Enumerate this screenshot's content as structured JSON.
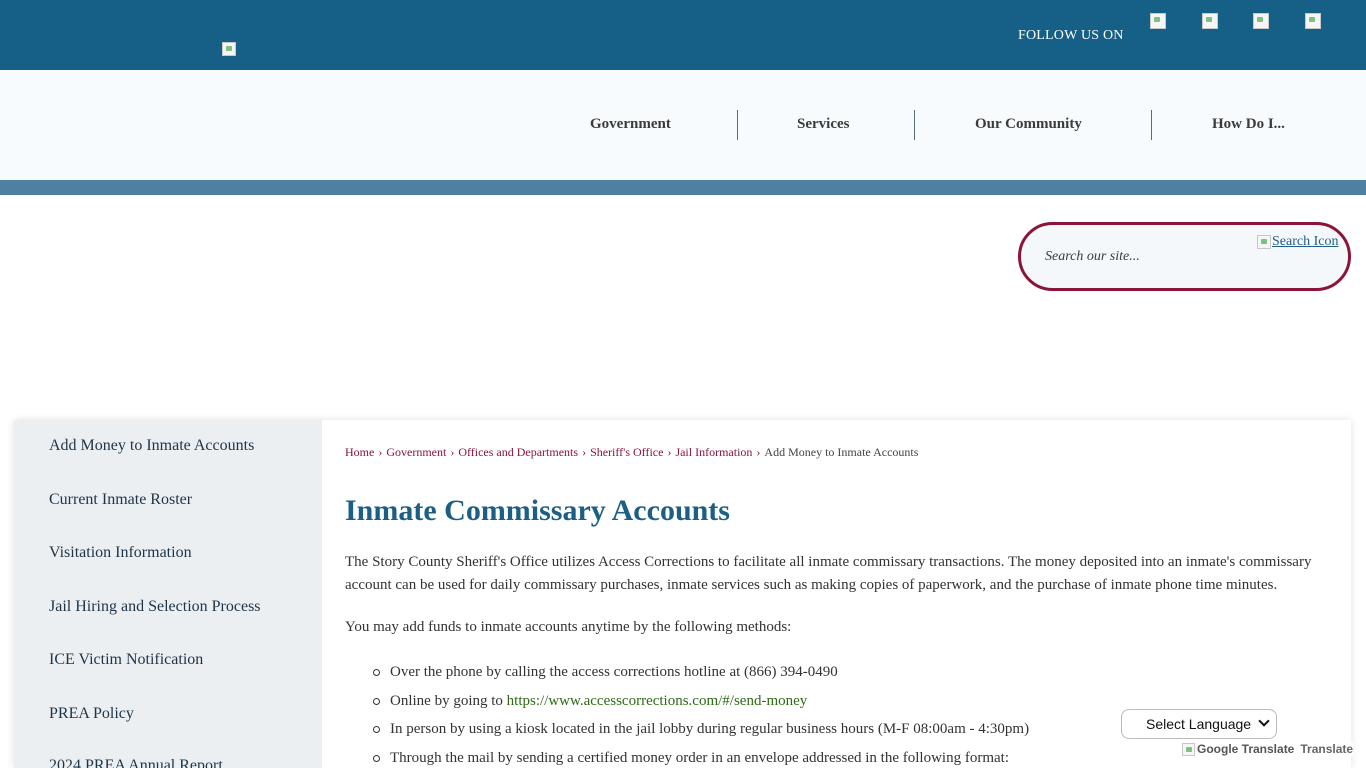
{
  "header": {
    "follow_label": "FOLLOW US ON"
  },
  "nav": {
    "items": [
      "Government",
      "Services",
      "Our Community",
      "How Do I..."
    ]
  },
  "search": {
    "placeholder": "Search our site...",
    "icon_alt": "Search Icon"
  },
  "sidebar": {
    "items": [
      "Add Money to Inmate Accounts",
      "Current Inmate Roster",
      "Visitation Information",
      "Jail Hiring and Selection Process",
      "ICE Victim Notification",
      "PREA Policy",
      "2024 PREA Annual Report"
    ]
  },
  "breadcrumb": {
    "items": [
      "Home",
      "Government",
      "Offices and Departments",
      "Sheriff's Office",
      "Jail Information"
    ],
    "separator": "›",
    "current": "Add Money to Inmate Accounts"
  },
  "main": {
    "title": "Inmate Commissary Accounts",
    "intro": "The Story County Sheriff's Office utilizes Access Corrections to facilitate all inmate commissary transactions. The money deposited into an inmate's commissary account can be used for daily commissary purchases, inmate services such as making copies of paperwork, and the purchase of inmate phone time minutes.",
    "methods_intro": "You may add funds to inmate accounts anytime by the following methods:",
    "methods": [
      {
        "text": "Over the phone by calling the access corrections hotline at (866) 394-0490",
        "link": ""
      },
      {
        "text": "Online by going to ",
        "link": "https://www.accesscorrections.com/#/send-money"
      },
      {
        "text": "In person by using a kiosk located in the jail lobby during regular business hours (M-F 08:00am - 4:30pm)",
        "link": ""
      },
      {
        "text": "Through the mail by sending a certified money order in an envelope addressed in the following format:",
        "link": ""
      }
    ]
  },
  "translate": {
    "select_label": "Select Language",
    "logo_alt": "Google Translate",
    "word": "Translate"
  }
}
